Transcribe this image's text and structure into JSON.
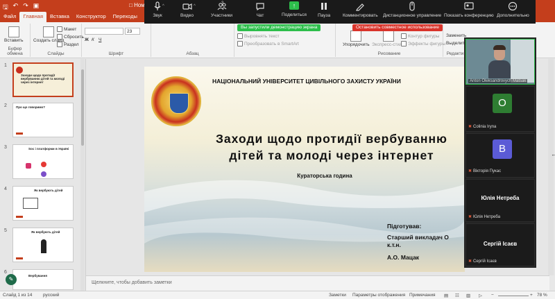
{
  "app": {
    "qa_icons": [
      "save-icon",
      "undo-icon",
      "redo-icon",
      "present-icon"
    ],
    "partial_window_label": "Ном"
  },
  "ribbon_tabs": [
    "Файл",
    "Главная",
    "Вставка",
    "Конструктор",
    "Переходы",
    "Ани"
  ],
  "ribbon": {
    "paste": "Вставить",
    "clipboard_group": "Буфер обмена",
    "create_slide": "Создать слайд",
    "layout": "Макет",
    "reset": "Сбросить",
    "section": "Раздел",
    "slides_group": "Слайды",
    "font_size": "23",
    "font_group": "Шрифт",
    "paragraph_group": "Абзац",
    "align_text": "Выровнять текст",
    "smartart": "Преобразовать в SmartArt",
    "arrange": "Упорядочить",
    "express_styles": "Экспресс-стили",
    "shape_outline": "Контур фигуры",
    "shape_effects": "Эффекты фигуры",
    "drawing_group": "Рисование",
    "replace": "Заменить",
    "select": "Выделить",
    "editing_group": "Редакти"
  },
  "zoom_toolbar": {
    "buttons": [
      {
        "label": "Звук",
        "icon": "microphone-icon"
      },
      {
        "label": "Видео",
        "icon": "video-camera-icon"
      },
      {
        "label": "Участники",
        "icon": "participants-icon",
        "count": "3"
      },
      {
        "label": "Чат",
        "icon": "chat-icon"
      },
      {
        "label": "Поделиться",
        "icon": "share-screen-icon"
      },
      {
        "label": "Пауза",
        "icon": "pause-icon"
      },
      {
        "label": "Комментировать",
        "icon": "annotate-pen-icon"
      },
      {
        "label": "Дистанционное управление",
        "icon": "remote-control-icon"
      },
      {
        "label": "Показать конференцию",
        "icon": "show-meeting-icon"
      },
      {
        "label": "Дополнительно",
        "icon": "more-icon"
      }
    ],
    "share_banner": "Вы запустили демонстрацию экрана",
    "stop_banner": "Остановить совместное использование"
  },
  "slides_panel": {
    "thumbnails": [
      {
        "num": "1",
        "title": "Заходи щодо протидії вербуванню дітей та молоді через інтернет",
        "active": true
      },
      {
        "num": "2",
        "title": "Про що говоримо?",
        "active": false
      },
      {
        "num": "3",
        "title": "Soc і платформи в Україні",
        "active": false
      },
      {
        "num": "4",
        "title": "Як вербують дітей",
        "active": false
      },
      {
        "num": "5",
        "title": "Як вербують дітей",
        "active": false
      },
      {
        "num": "6",
        "title": "Вербування",
        "active": false
      }
    ]
  },
  "slide": {
    "university": "НАЦІОНАЛЬНИЙ УНІВЕРСИТЕТ ЦИВІЛЬНОГО ЗАХИСТУ УКРАЇНИ",
    "title_line1": "Заходи щодо протидії вербуванню",
    "title_line2": "дітей та молоді через інтернет",
    "subtitle": "Кураторська година",
    "prepared_label": "Підготував:",
    "prepared_by_line1": "Старший викладач О",
    "prepared_by_line2": "к.т.н.",
    "prepared_initials": "А.О. Мацак"
  },
  "notes_placeholder": "Щелкните, чтобы добавить заметки",
  "statusbar": {
    "slide_info": "Слайд 1 из 14",
    "language": "русский",
    "notes": "Заметки",
    "display_settings": "Параметры отображения",
    "comments": "Примечания",
    "zoom": "78 %"
  },
  "participants": [
    {
      "name": "Anton Oleksandrovych Matsak",
      "type": "video",
      "muted": false
    },
    {
      "name": "Colinia Iryna",
      "type": "avatar",
      "initial": "O",
      "color": "#2e7d32",
      "muted": true
    },
    {
      "name": "Вікторія Пукас",
      "type": "avatar",
      "initial": "B",
      "color": "#5b5bd6",
      "muted": true
    },
    {
      "name": "Юлія Нетреба",
      "type": "name",
      "muted": true
    },
    {
      "name": "Сергій Ісаєв",
      "type": "name",
      "muted": true
    }
  ],
  "colors": {
    "office_accent": "#c43e1c",
    "zoom_green": "#2dbe4b",
    "zoom_red": "#d9342b"
  }
}
